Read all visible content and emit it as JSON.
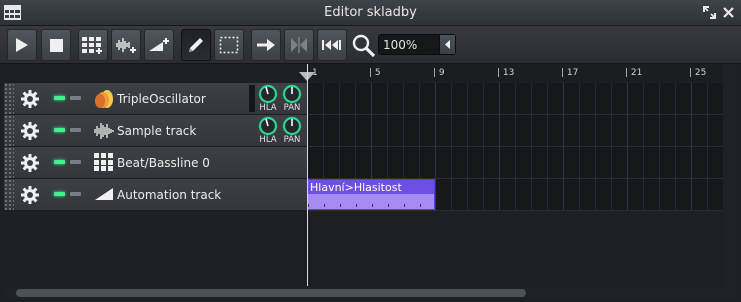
{
  "window": {
    "title": "Editor skladby"
  },
  "toolbar": {
    "buttons": [
      {
        "name": "play-button",
        "icon": "play-icon"
      },
      {
        "name": "stop-button",
        "icon": "stop-icon"
      },
      {
        "name": "add-beat-bassline-button",
        "icon": "beat-grid-add-icon"
      },
      {
        "name": "add-sample-track-button",
        "icon": "waveform-add-icon"
      },
      {
        "name": "add-automation-track-button",
        "icon": "automation-add-icon"
      },
      {
        "name": "draw-mode-button",
        "icon": "pencil-icon",
        "active": true
      },
      {
        "name": "edit-mode-button",
        "icon": "selection-rect-icon"
      },
      {
        "name": "auto-scroll-button",
        "icon": "arrow-right-icon"
      },
      {
        "name": "loop-points-button",
        "icon": "loop-points-icon"
      },
      {
        "name": "stop-behaviour-button",
        "icon": "rewind-start-icon"
      }
    ],
    "zoom": {
      "icon": "magnifier-icon",
      "value": "100%"
    }
  },
  "ruler": {
    "labels": [
      "1",
      "| 5",
      "| 9",
      "| 13",
      "| 17",
      "| 21",
      "| 25"
    ]
  },
  "tracks": [
    {
      "name": "TripleOscillator",
      "icon": "triple-oscillator-icon",
      "knobs": [
        "HLA",
        "PAN"
      ]
    },
    {
      "name": "Sample track",
      "icon": "waveform-icon",
      "knobs": [
        "HLA",
        "PAN"
      ]
    },
    {
      "name": "Beat/Bassline 0",
      "icon": "beat-grid-icon"
    },
    {
      "name": "Automation track",
      "icon": "automation-ramp-icon"
    }
  ],
  "clips": [
    {
      "track": 3,
      "label": "Hlavní>Hlasitost",
      "color": "#a68cf2"
    }
  ],
  "colors": {
    "accent_led": "#3ff28a",
    "knob_ring": "#2fd48c",
    "automation_clip": "#6e4fe3"
  }
}
